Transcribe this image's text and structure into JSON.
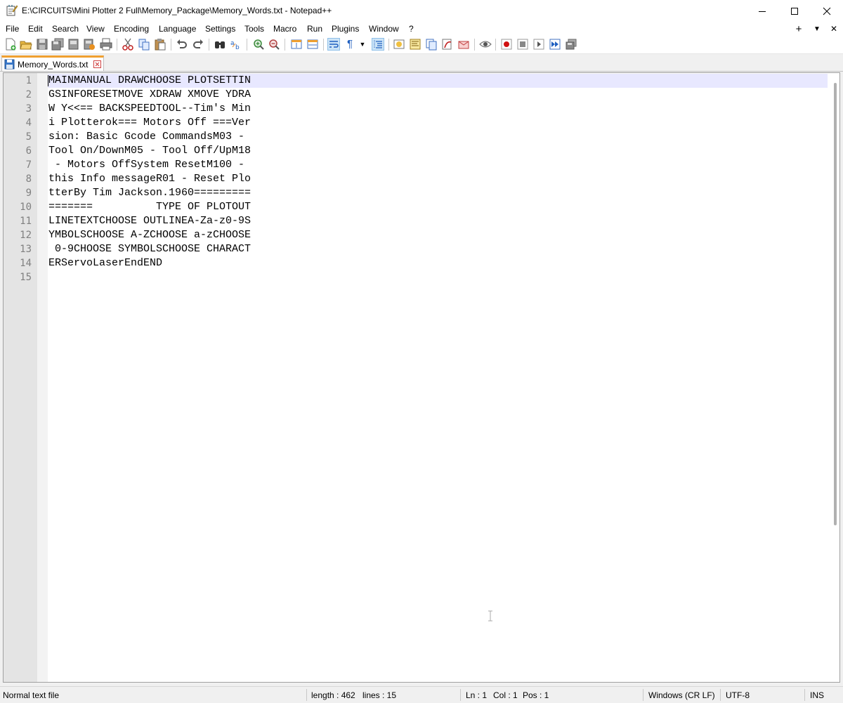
{
  "window": {
    "title": "E:\\CIRCUITS\\Mini Plotter 2 Full\\Memory_Package\\Memory_Words.txt - Notepad++",
    "app_icon": "notepad-icon"
  },
  "menu": {
    "items": [
      "File",
      "Edit",
      "Search",
      "View",
      "Encoding",
      "Language",
      "Settings",
      "Tools",
      "Macro",
      "Run",
      "Plugins",
      "Window",
      "?"
    ],
    "right": {
      "add": "+",
      "dropdown": "▼",
      "close": "✕"
    }
  },
  "toolbar": {
    "buttons": [
      "new-file-icon",
      "open-file-icon",
      "save-icon",
      "save-all-icon",
      "close-icon",
      "close-all-icon",
      "print-icon",
      "cut-icon",
      "copy-icon",
      "paste-icon",
      "undo-icon",
      "redo-icon",
      "find-icon",
      "replace-icon",
      "zoom-in-icon",
      "zoom-out-icon",
      "sync-vertical-icon",
      "sync-horizontal-icon",
      "word-wrap-icon",
      "show-all-characters-icon",
      "indent-guide-icon",
      "define-language-icon",
      "document-map-icon",
      "function-list-icon",
      "folder-as-workspace-icon",
      "monitoring-icon",
      "record-macro-icon",
      "stop-record-icon",
      "play-macro-icon",
      "run-macro-multiple-icon",
      "save-macro-icon"
    ]
  },
  "tabs": [
    {
      "label": "Memory_Words.txt",
      "active": true
    }
  ],
  "editor": {
    "line_numbers": [
      "1",
      "2",
      "3",
      "4",
      "5",
      "6",
      "7",
      "8",
      "9",
      "10",
      "11",
      "12",
      "13",
      "14",
      "15"
    ],
    "lines": [
      "MAINMANUAL DRAWCHOOSE PLOTSETTIN",
      "GSINFORESETMOVE XDRAW XMOVE YDRA",
      "W Y<<== BACKSPEEDTOOL--Tim's Min",
      "i Plotterok=== Motors Off ===Ver",
      "sion: Basic Gcode CommandsM03 -",
      "Tool On/DownM05 - Tool Off/UpM18",
      " - Motors OffSystem ResetM100 -",
      "this Info messageR01 - Reset Plo",
      "tterBy Tim Jackson.1960=========",
      "=======          TYPE OF PLOTOUT",
      "LINETEXTCHOOSE OUTLINEA-Za-z0-9S",
      "YMBOLSCHOOSE A-ZCHOOSE a-zCHOOSE",
      " 0-9CHOOSE SYMBOLSCHOOSE CHARACT",
      "ERServoLaserEndEND",
      ""
    ],
    "current_line": 1
  },
  "status": {
    "file_type": "Normal text file",
    "length": "length : 462",
    "lines": "lines : 15",
    "ln": "Ln : 1",
    "col": "Col : 1",
    "pos": "Pos : 1",
    "eol": "Windows (CR LF)",
    "encoding": "UTF-8",
    "mode": "INS"
  },
  "colors": {
    "current_line_bg": "#e8e8ff",
    "tab_accent": "#f0a030",
    "gutter_bg": "#e4e4e4",
    "line_number_fg": "#808080"
  }
}
